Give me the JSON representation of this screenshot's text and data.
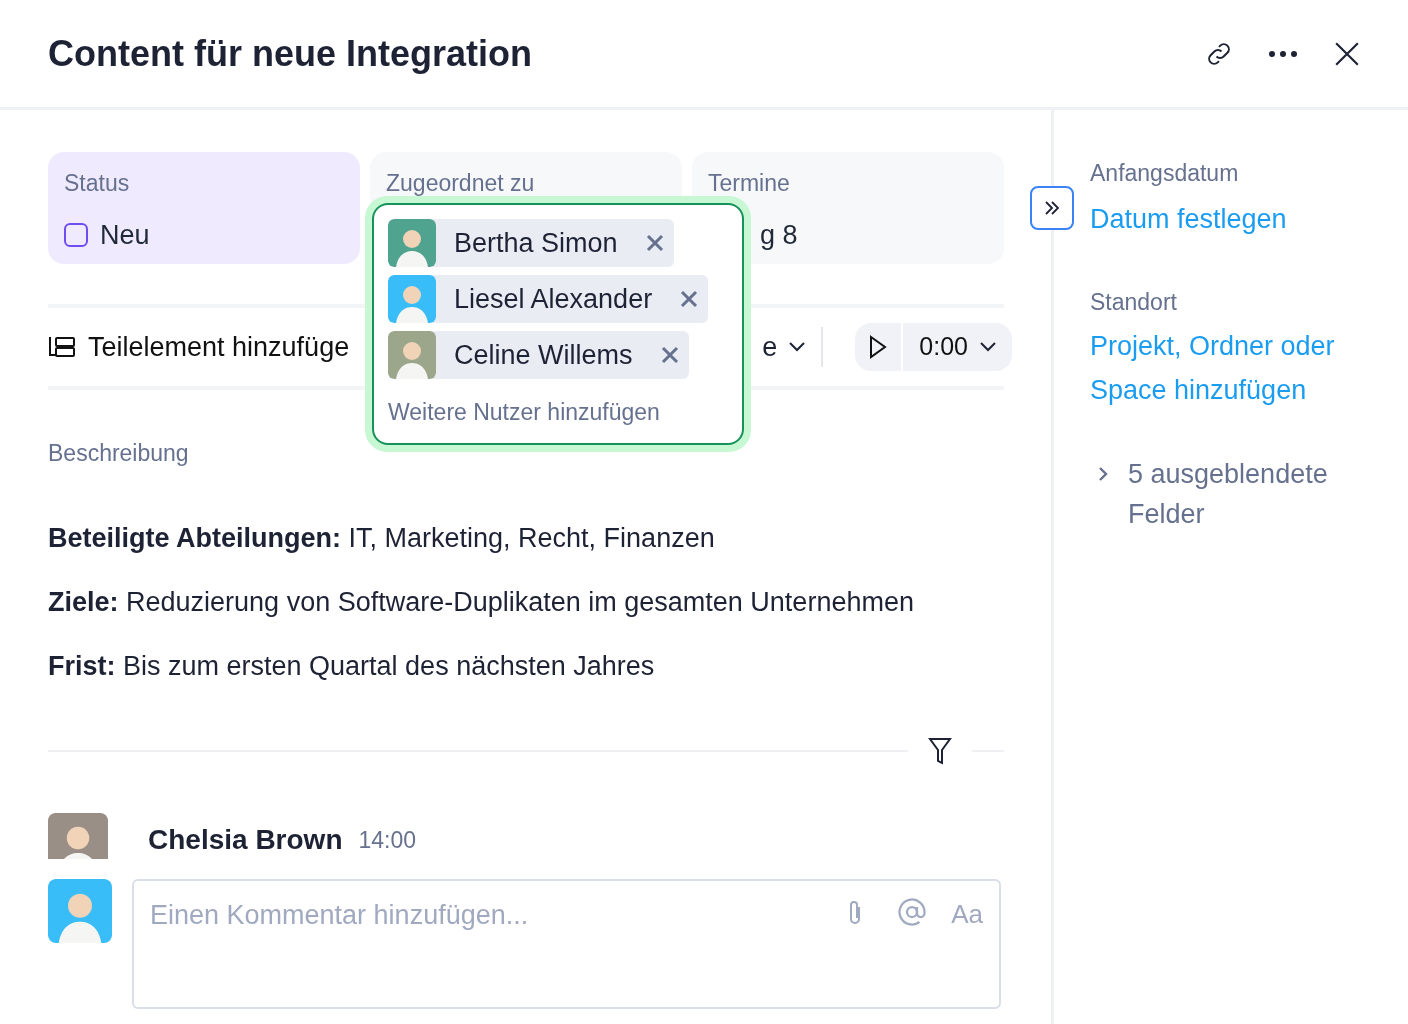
{
  "title": "Content für neue Integration",
  "fields": [
    {
      "label": "Status",
      "value": "Neu",
      "kind": "status",
      "checked": false
    },
    {
      "label": "Zugeordnet zu",
      "kind": "assignee"
    },
    {
      "label": "Termine",
      "value": "g 8",
      "kind": "date"
    }
  ],
  "assignee_popup": {
    "people": [
      {
        "name": "Bertha Simon",
        "color": "#4fa38f"
      },
      {
        "name": "Liesel Alexander",
        "color": "#38bdf8"
      },
      {
        "name": "Celine Willems",
        "color": "#9ca68a"
      }
    ],
    "add_more": "Weitere Nutzer hinzufügen"
  },
  "toolbar": {
    "subtask": "Teilelement hinzufüge",
    "dropdown": "e",
    "timer": "0:00"
  },
  "description": {
    "label": "Beschreibung",
    "paragraphs": [
      "**Beteiligte Abteilungen:** IT, Marketing, Recht, Finanzen",
      "**Ziele:** Reduzierung von Software-Duplikaten im gesamten Unternehmen",
      "**Frist:** Bis zum ersten Quartal des nächsten Jahres"
    ]
  },
  "activity": {
    "author": "Chelsia Brown",
    "time": "14:00",
    "comment_placeholder": "Einen Kommentar hinzufügen...",
    "format_button": "Aa"
  },
  "sidebar": {
    "start_label": "Anfangsdatum",
    "start_link": "Datum festlegen",
    "location_label": "Standort",
    "location_link": "Projekt, Ordner oder Space hinzufügen",
    "hidden_fields": "5 ausgeblendete Felder"
  }
}
